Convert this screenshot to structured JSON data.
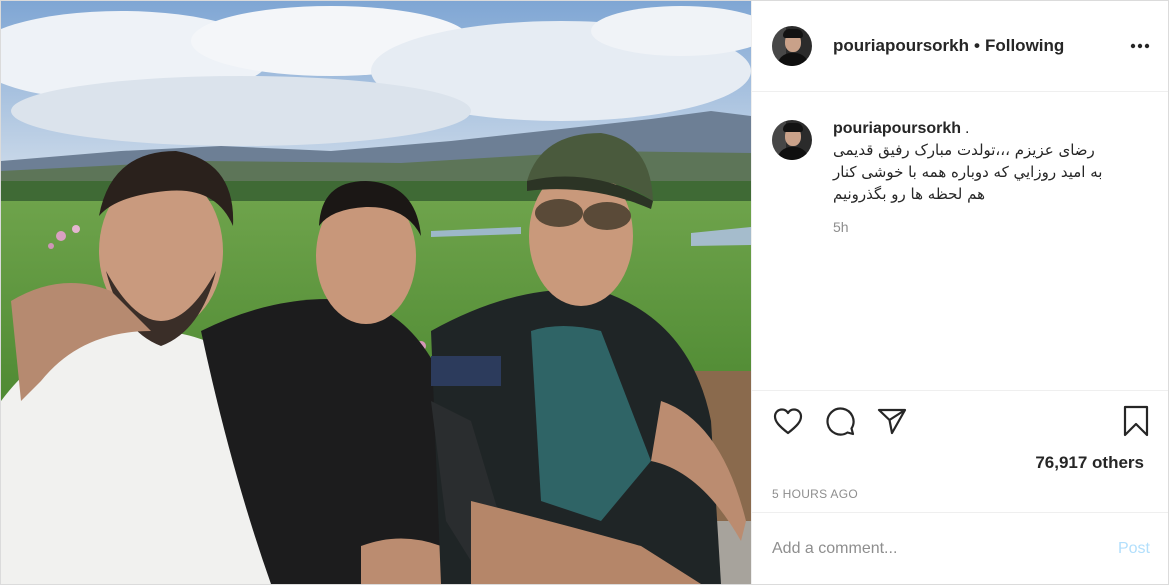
{
  "post": {
    "photo_alt": "",
    "header": {
      "username": "pouriapoursorkh",
      "separator": "•",
      "follow_status": "Following"
    },
    "caption": {
      "username": "pouriapoursorkh",
      "after_username": ".",
      "lines": [
        "رضای عزیزم ،،،تولدت مبارک رفیق قدیمی",
        "به امید روزایي که دوباره همه با خوشی کنار",
        "هم لحظه ها رو بگذرونیم"
      ],
      "time_ago": "5h"
    },
    "actions": {
      "like_icon": "heart-icon",
      "comment_icon": "comment-bubble-icon",
      "share_icon": "paper-plane-icon",
      "save_icon": "bookmark-icon"
    },
    "likes_text": "76,917 others",
    "timestamp": "5 HOURS AGO",
    "comment_box": {
      "placeholder": "Add a comment...",
      "post_label": "Post",
      "post_color": "#b2dffc"
    }
  }
}
